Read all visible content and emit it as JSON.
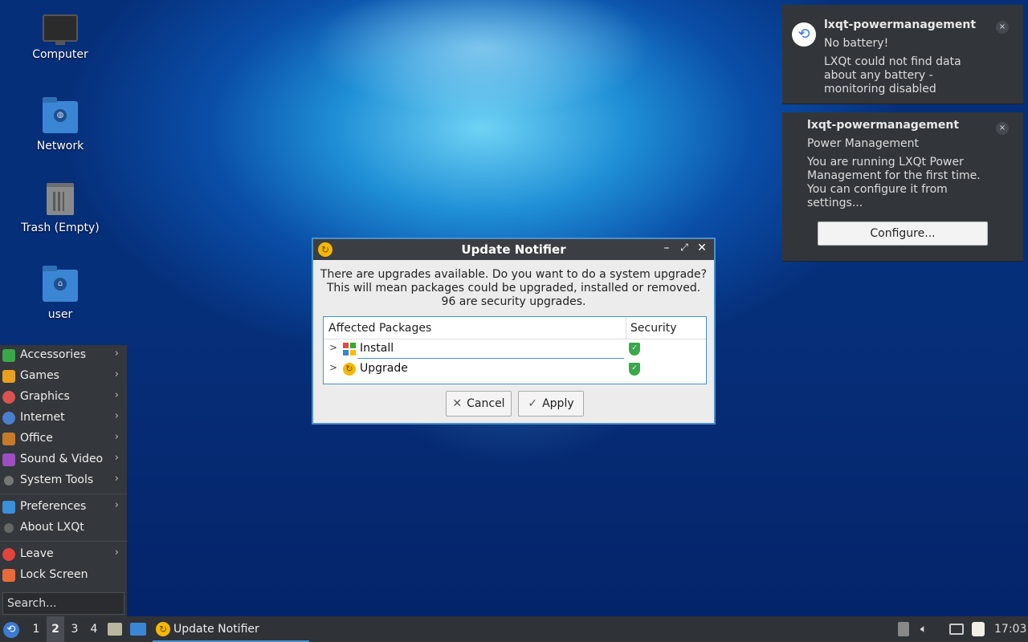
{
  "desktop": {
    "icons": [
      {
        "label": "Computer"
      },
      {
        "label": "Network"
      },
      {
        "label": "Trash (Empty)"
      },
      {
        "label": "user"
      }
    ]
  },
  "notifications": [
    {
      "app": "lxqt-powermanagement",
      "summary": "No battery!",
      "body": "LXQt could not find data about any battery - monitoring disabled",
      "close": "×"
    },
    {
      "app": "lxqt-powermanagement",
      "summary": "Power Management",
      "body": "You are running LXQt Power Management for the first time. You can configure it from settings...",
      "action": "Configure...",
      "close": "×"
    }
  ],
  "dialog": {
    "title": "Update Notifier",
    "message_lines": [
      "There are upgrades available. Do you want to do a system upgrade?",
      "This will mean packages could be upgraded, installed or removed.",
      "96 are security upgrades."
    ],
    "columns": [
      "Affected Packages",
      "Security"
    ],
    "rows": [
      {
        "name": "Install"
      },
      {
        "name": "Upgrade"
      }
    ],
    "cancel_label": "Cancel",
    "apply_label": "Apply"
  },
  "menu": {
    "items": [
      {
        "label": "Accessories",
        "color": "#3aa84a"
      },
      {
        "label": "Games",
        "color": "#e8a020"
      },
      {
        "label": "Graphics",
        "color": "#d9534f"
      },
      {
        "label": "Internet",
        "color": "#4a7fd0"
      },
      {
        "label": "Office",
        "color": "#c77a2a"
      },
      {
        "label": "Sound & Video",
        "color": "#9b4fc0"
      },
      {
        "label": "System Tools",
        "color": "#777777"
      }
    ],
    "items2": [
      {
        "label": "Preferences",
        "color": "#3b8fd9"
      },
      {
        "label": "About LXQt",
        "color": "#666666"
      }
    ],
    "items3": [
      {
        "label": "Leave",
        "color": "#e0443c"
      },
      {
        "label": "Lock Screen",
        "color": "#e86a3a"
      }
    ],
    "search_placeholder": "Search..."
  },
  "taskbar": {
    "desktops": [
      "1",
      "2",
      "3",
      "4"
    ],
    "active_desktop": "2",
    "task_label": "Update Notifier",
    "clock": "17:03"
  }
}
